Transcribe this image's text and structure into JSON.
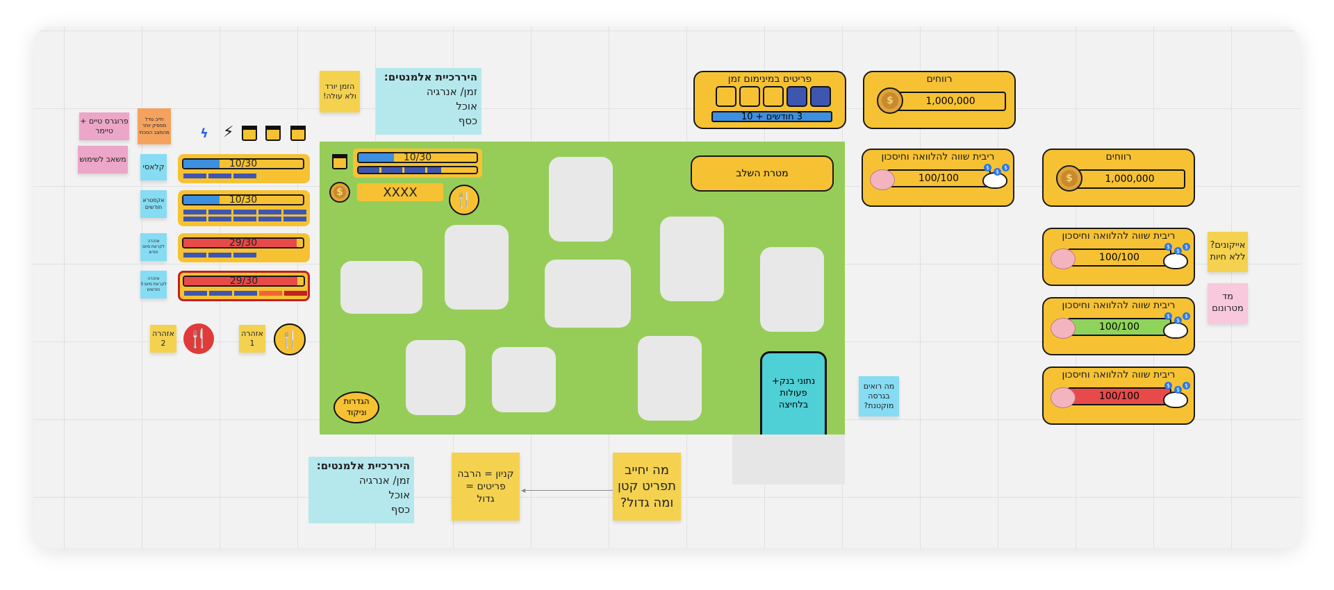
{
  "notes": {
    "progress_timer": "פרוגרס טיים + טיימר",
    "orange_note": "חייב גודל מספיק יותר מהמצב הנוכחי",
    "resource": "משאב לשימוש",
    "time_down": "הזמן יורד ולא עולה!",
    "classic": "קלאסי",
    "extra_months": "אקסטרא חודשים",
    "warning_month": "אזהרה לקראת סיום חודש",
    "warning_3months": "אזהרה לקראת סיום 3 חודשים",
    "warning2": "אזהרה 2",
    "warning1": "אזהרה 1",
    "what_small": "מה רואים בגרסה מוקטנת?",
    "icons": "אייקונים? ללא חיות",
    "meter": "מד מטרונום",
    "purchase": "קניון = הרבה פריטים = גדול",
    "requires": "מה יחייב תפריט קטן ומה גדול?"
  },
  "hierarchy_top": {
    "title": "היררכיית אלמנטים:",
    "line1": "זמן/ אנרגיה",
    "line2": "אוכל",
    "line3": "כסף"
  },
  "hierarchy_bottom": {
    "title": "היררכיית אלמנטים:",
    "line1": "זמן/ אנרגיה",
    "line2": "אוכל",
    "line3": "כסף"
  },
  "left_bars": [
    {
      "label": "10/30",
      "fill_pct": 30,
      "color": "#3d8fe0"
    },
    {
      "label": "10/30",
      "fill_pct": 30,
      "color": "#3d8fe0"
    },
    {
      "label": "29/30",
      "fill_pct": 95,
      "color": "#e84a4a"
    },
    {
      "label": "29/30",
      "fill_pct": 95,
      "color": "#e84a4a"
    }
  ],
  "game": {
    "top_bar_label": "10/30",
    "money_label": "XXXX",
    "stage_goal": "מטרת השלב",
    "settings": "הגדרות וניקוד",
    "bank": "נתוני בנק+ פעולות בלחיצה"
  },
  "right": {
    "timed_items_title": "פריטים במינימום זמן",
    "timed_items_bar": "3 חודשים + 10",
    "profit1_title": "רווחים",
    "profit1_value": "1,000,000",
    "profit2_title": "רווחים",
    "profit2_value": "1,000,000",
    "loan_title": "ריבית שווה להלוואה וחיסכון",
    "loan_value": "100/100",
    "loan2_title": "ריבית שווה להלוואה וחיסכון",
    "loan2_value": "100/100",
    "loan3_title": "ריבית שווה להלוואה וחיסכון",
    "loan3_value": "100/100",
    "loan4_title": "ריבית שווה להלוואה וחיסכון",
    "loan4_value": "100/100"
  },
  "colors": {
    "board_green": "#96cd58",
    "card_yellow": "#f6c234",
    "bar_blue": "#3d8fe0",
    "bar_red": "#e84a4a",
    "segment_blue": "#3f56b0",
    "bank_teal": "#4fcfd6"
  }
}
